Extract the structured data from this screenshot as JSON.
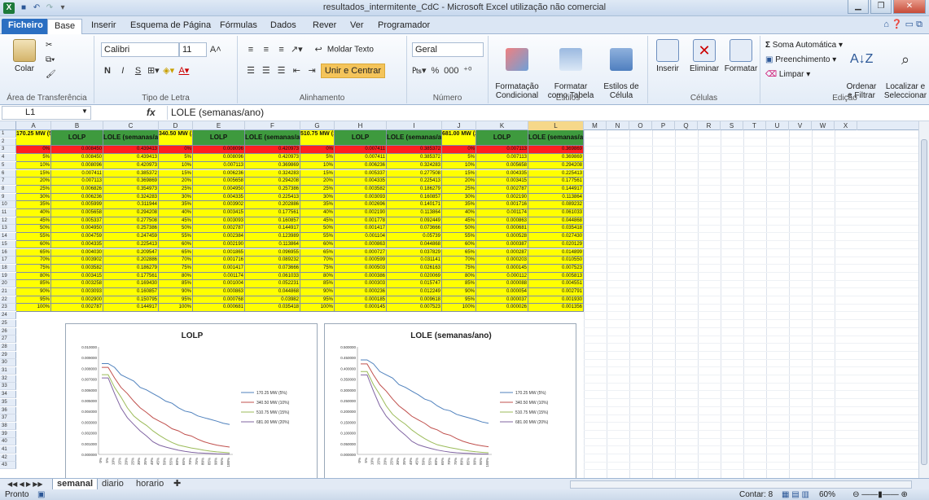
{
  "window": {
    "title": "resultados_intermitente_CdC - Microsoft Excel utilização não comercial"
  },
  "tabs": [
    "Ficheiro",
    "Base",
    "Inserir",
    "Esquema de Página",
    "Fórmulas",
    "Dados",
    "Rever",
    "Ver",
    "Programador"
  ],
  "ribbon": {
    "clipboard": {
      "paste": "Colar",
      "label": "Área de Transferência"
    },
    "font": {
      "name": "Calibri",
      "size": "11",
      "bold": "N",
      "italic": "I",
      "underline": "S",
      "label": "Tipo de Letra"
    },
    "alignment": {
      "wrap": "Moldar Texto",
      "merge": "Unir e Centrar",
      "label": "Alinhamento"
    },
    "number": {
      "format": "Geral",
      "percent": "%",
      "thousands": "000",
      "label": "Número"
    },
    "styles": {
      "conditional": "Formatação\nCondicional",
      "as_table": "Formatar\ncomo Tabela",
      "cell_styles": "Estilos de\nCélula",
      "label": "Estilos"
    },
    "cells": {
      "insert": "Inserir",
      "delete": "Eliminar",
      "format": "Formatar",
      "label": "Células"
    },
    "editing": {
      "autosum": "Soma Automática",
      "fill": "Preenchimento",
      "clear": "Limpar",
      "sort": "Ordenar\ne Filtrar",
      "find": "Localizar e\nSeleccionar",
      "label": "Edição"
    }
  },
  "formula_bar": {
    "cell": "L1",
    "fx": "fx",
    "content": "LOLE (semanas/ano)"
  },
  "sheet": {
    "columns": [
      "A",
      "B",
      "C",
      "D",
      "E",
      "F",
      "G",
      "H",
      "I",
      "J",
      "K",
      "L",
      "M",
      "N",
      "O",
      "P",
      "Q",
      "R",
      "S",
      "T",
      "U",
      "V",
      "W",
      "X"
    ],
    "rows": [
      "1",
      "2",
      "3",
      "4",
      "5",
      "6",
      "7",
      "8",
      "9",
      "10",
      "11",
      "12",
      "13",
      "14",
      "15",
      "16",
      "17",
      "18",
      "19",
      "20",
      "21",
      "22",
      "23",
      "24",
      "25",
      "26",
      "27",
      "28",
      "29",
      "30",
      "31",
      "32",
      "33",
      "34",
      "35",
      "36",
      "37",
      "38",
      "39",
      "40",
      "41",
      "42",
      "43"
    ],
    "headers": {
      "a": "170.25 MW (5%)",
      "b": "LOLP",
      "c": "LOLE (semanas/ano)",
      "d": "340.50 MW (10%)",
      "e": "LOLP",
      "f": "LOLE (semanas/ano)",
      "g": "510.75 MW (15%)",
      "h": "LOLP",
      "i": "LOLE (semanas/ano)",
      "j": "681.00 MW (20%)",
      "k": "LOLP",
      "l": "LOLE (semanas/ano)"
    },
    "pcts": [
      "0%",
      "5%",
      "10%",
      "15%",
      "20%",
      "25%",
      "30%",
      "35%",
      "40%",
      "45%",
      "50%",
      "55%",
      "60%",
      "65%",
      "70%",
      "75%",
      "80%",
      "85%",
      "90%",
      "95%",
      "100%"
    ],
    "data": [
      [
        "0.008450",
        "0.439413",
        "0.008096",
        "0.420973",
        "0.007411",
        "0.385372",
        "0.007113",
        "0.369869"
      ],
      [
        "0.008450",
        "0.439413",
        "0.008096",
        "0.420973",
        "0.007411",
        "0.385372",
        "0.007113",
        "0.369869"
      ],
      [
        "0.008096",
        "0.420973",
        "0.007113",
        "0.369869",
        "0.006236",
        "0.324283",
        "0.005658",
        "0.294208"
      ],
      [
        "0.007411",
        "0.385372",
        "0.006236",
        "0.324283",
        "0.005337",
        "0.277508",
        "0.004335",
        "0.225413"
      ],
      [
        "0.007113",
        "0.369869",
        "0.005658",
        "0.294208",
        "0.004335",
        "0.225413",
        "0.003415",
        "0.177561"
      ],
      [
        "0.006826",
        "0.354973",
        "0.004950",
        "0.257386",
        "0.003582",
        "0.186279",
        "0.002787",
        "0.144917"
      ],
      [
        "0.006236",
        "0.324283",
        "0.004335",
        "0.225413",
        "0.003093",
        "0.160857",
        "0.002190",
        "0.113864"
      ],
      [
        "0.005999",
        "0.311944",
        "0.003902",
        "0.202886",
        "0.002696",
        "0.140171",
        "0.001716",
        "0.089232"
      ],
      [
        "0.005658",
        "0.294208",
        "0.003415",
        "0.177561",
        "0.002190",
        "0.113864",
        "0.001174",
        "0.061033"
      ],
      [
        "0.005337",
        "0.277508",
        "0.003093",
        "0.160857",
        "0.001778",
        "0.092449",
        "0.000863",
        "0.044868"
      ],
      [
        "0.004950",
        "0.257386",
        "0.002787",
        "0.144917",
        "0.001417",
        "0.073666",
        "0.000681",
        "0.035418"
      ],
      [
        "0.004759",
        "0.247459",
        "0.002384",
        "0.123989",
        "0.001104",
        "0.05739",
        "0.000528",
        "0.027430"
      ],
      [
        "0.004335",
        "0.225413",
        "0.002190",
        "0.113864",
        "0.000863",
        "0.044868",
        "0.000387",
        "0.020129"
      ],
      [
        "0.004030",
        "0.209547",
        "0.001865",
        "0.096955",
        "0.000727",
        "0.037829",
        "0.000287",
        "0.014899"
      ],
      [
        "0.003902",
        "0.202886",
        "0.001716",
        "0.089232",
        "0.000599",
        "0.031141",
        "0.000203",
        "0.010550"
      ],
      [
        "0.003582",
        "0.186279",
        "0.001417",
        "0.073666",
        "0.000503",
        "0.026163",
        "0.000145",
        "0.007523"
      ],
      [
        "0.003415",
        "0.177561",
        "0.001174",
        "0.061033",
        "0.000386",
        "0.020069",
        "0.000112",
        "0.005813"
      ],
      [
        "0.003258",
        "0.169430",
        "0.001004",
        "0.052231",
        "0.000303",
        "0.015747",
        "0.000088",
        "0.004551"
      ],
      [
        "0.003093",
        "0.160857",
        "0.000863",
        "0.044868",
        "0.000236",
        "0.012249",
        "0.000054",
        "0.002791"
      ],
      [
        "0.002900",
        "0.150795",
        "0.000768",
        "0.03982",
        "0.000185",
        "0.009618",
        "0.000037",
        "0.001930"
      ],
      [
        "0.002787",
        "0.144917",
        "0.000681",
        "0.035418",
        "0.000145",
        "0.007523",
        "0.000026",
        "0.001356"
      ]
    ]
  },
  "chart_data": [
    {
      "type": "line",
      "title": "LOLP",
      "categories": [
        "0%",
        "5%",
        "10%",
        "15%",
        "20%",
        "25%",
        "30%",
        "35%",
        "40%",
        "45%",
        "50%",
        "55%",
        "60%",
        "65%",
        "70%",
        "75%",
        "80%",
        "85%",
        "90%",
        "95%",
        "100%"
      ],
      "yticks": [
        "0.000000",
        "0.001000",
        "0.002000",
        "0.003000",
        "0.004000",
        "0.005000",
        "0.006000",
        "0.007000",
        "0.008000",
        "0.009000",
        "0.010000"
      ],
      "ylim": [
        0,
        0.01
      ],
      "legend": "right",
      "grid": false,
      "series": [
        {
          "name": "170.25 MW (5%)",
          "color": "#4f81bd",
          "values": [
            0.00845,
            0.00845,
            0.008096,
            0.007411,
            0.007113,
            0.006826,
            0.006236,
            0.005999,
            0.005658,
            0.005337,
            0.00495,
            0.004759,
            0.004335,
            0.00403,
            0.003902,
            0.003582,
            0.003415,
            0.003258,
            0.003093,
            0.0029,
            0.002787
          ]
        },
        {
          "name": "340.50 MW (10%)",
          "color": "#c0504d",
          "values": [
            0.008096,
            0.008096,
            0.007113,
            0.006236,
            0.005658,
            0.00495,
            0.004335,
            0.003902,
            0.003415,
            0.003093,
            0.002787,
            0.002384,
            0.00219,
            0.001865,
            0.001716,
            0.001417,
            0.001174,
            0.001004,
            0.000863,
            0.000768,
            0.000681
          ]
        },
        {
          "name": "510.75 MW (15%)",
          "color": "#9bbb59",
          "values": [
            0.007411,
            0.007411,
            0.006236,
            0.005337,
            0.004335,
            0.003582,
            0.003093,
            0.002696,
            0.00219,
            0.001778,
            0.001417,
            0.001104,
            0.000863,
            0.000727,
            0.000599,
            0.000503,
            0.000386,
            0.000303,
            0.000236,
            0.000185,
            0.000145
          ]
        },
        {
          "name": "681.00 MW (20%)",
          "color": "#8064a2",
          "values": [
            0.007113,
            0.007113,
            0.005658,
            0.004335,
            0.003415,
            0.002787,
            0.00219,
            0.001716,
            0.001174,
            0.000863,
            0.000681,
            0.000528,
            0.000387,
            0.000287,
            0.000203,
            0.000145,
            0.000112,
            8.8e-05,
            5.4e-05,
            3.7e-05,
            2.6e-05
          ]
        }
      ]
    },
    {
      "type": "line",
      "title": "LOLE (semanas/ano)",
      "categories": [
        "0%",
        "5%",
        "10%",
        "15%",
        "20%",
        "25%",
        "30%",
        "35%",
        "40%",
        "45%",
        "50%",
        "55%",
        "60%",
        "65%",
        "70%",
        "75%",
        "80%",
        "85%",
        "90%",
        "95%",
        "100%"
      ],
      "yticks": [
        "0.000000",
        "0.050000",
        "0.100000",
        "0.150000",
        "0.200000",
        "0.250000",
        "0.300000",
        "0.350000",
        "0.400000",
        "0.450000",
        "0.500000"
      ],
      "ylim": [
        0,
        0.5
      ],
      "legend": "right",
      "grid": false,
      "series": [
        {
          "name": "170.25 MW (5%)",
          "color": "#4f81bd",
          "values": [
            0.439413,
            0.439413,
            0.420973,
            0.385372,
            0.369869,
            0.354973,
            0.324283,
            0.311944,
            0.294208,
            0.277508,
            0.257386,
            0.247459,
            0.225413,
            0.209547,
            0.202886,
            0.186279,
            0.177561,
            0.16943,
            0.160857,
            0.150795,
            0.144917
          ]
        },
        {
          "name": "340.50 MW (10%)",
          "color": "#c0504d",
          "values": [
            0.420973,
            0.420973,
            0.369869,
            0.324283,
            0.294208,
            0.257386,
            0.225413,
            0.202886,
            0.177561,
            0.160857,
            0.144917,
            0.123989,
            0.113864,
            0.096955,
            0.089232,
            0.073666,
            0.061033,
            0.052231,
            0.044868,
            0.03982,
            0.035418
          ]
        },
        {
          "name": "510.75 MW (15%)",
          "color": "#9bbb59",
          "values": [
            0.385372,
            0.385372,
            0.324283,
            0.277508,
            0.225413,
            0.186279,
            0.160857,
            0.140171,
            0.113864,
            0.092449,
            0.073666,
            0.05739,
            0.044868,
            0.037829,
            0.031141,
            0.026163,
            0.020069,
            0.015747,
            0.012249,
            0.009618,
            0.007523
          ]
        },
        {
          "name": "681.00 MW (20%)",
          "color": "#8064a2",
          "values": [
            0.369869,
            0.369869,
            0.294208,
            0.225413,
            0.177561,
            0.144917,
            0.113864,
            0.089232,
            0.061033,
            0.044868,
            0.035418,
            0.02743,
            0.020129,
            0.014899,
            0.01055,
            0.007523,
            0.005813,
            0.004551,
            0.002791,
            0.00193,
            0.001356
          ]
        }
      ]
    }
  ],
  "sheet_tabs": [
    "semanal",
    "diario",
    "horario"
  ],
  "status": {
    "ready": "Pronto",
    "count": "Contar: 8",
    "zoom": "60%"
  }
}
